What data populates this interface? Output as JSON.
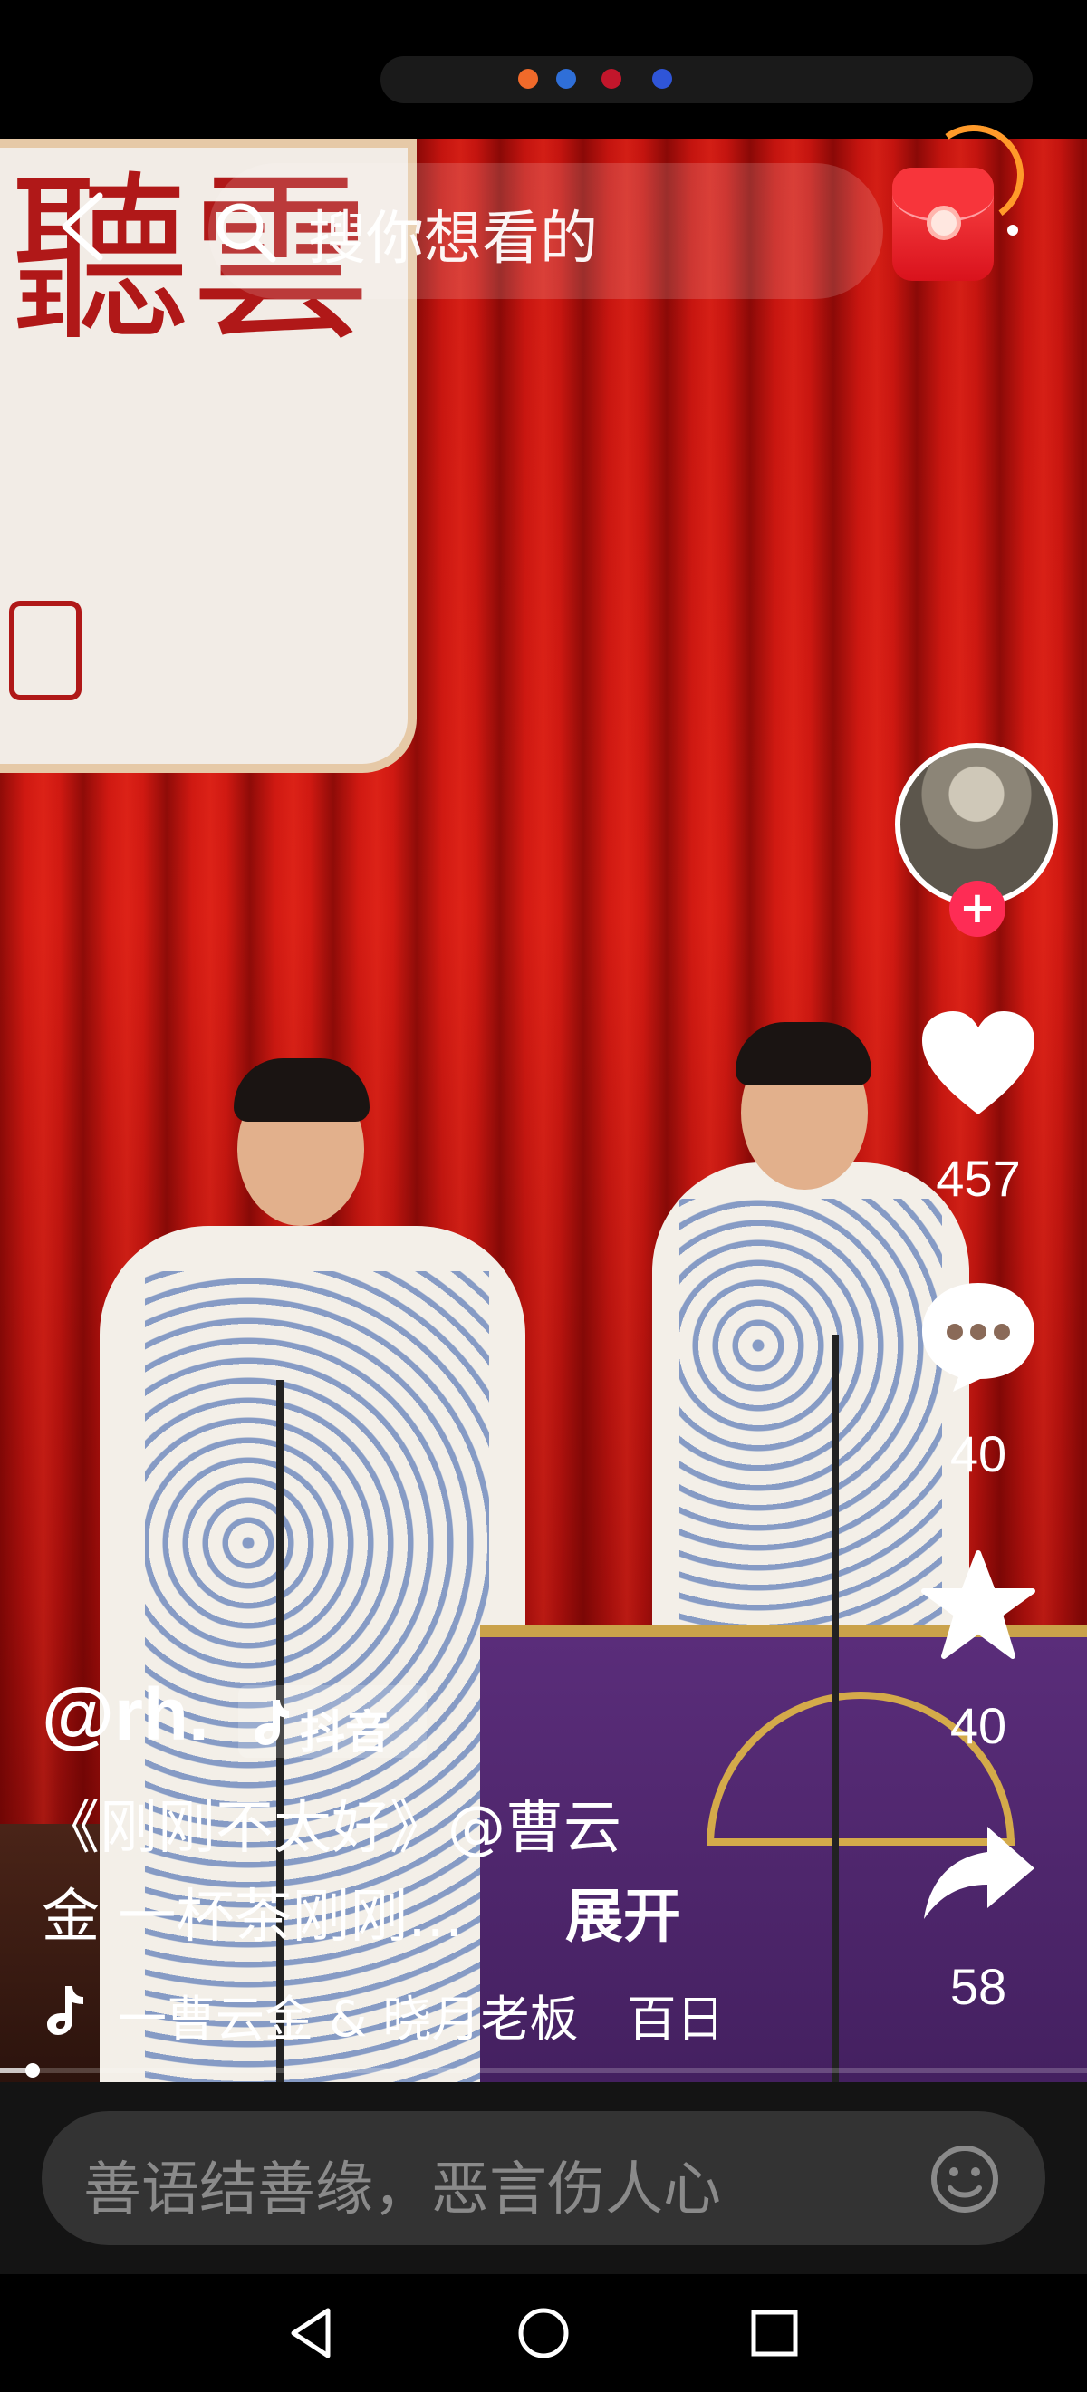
{
  "header": {
    "search_placeholder": "搜你想看的"
  },
  "video": {
    "banner_text": "聽雲"
  },
  "rail": {
    "likes": "457",
    "comments": "40",
    "favorites": "40",
    "shares": "58"
  },
  "caption": {
    "author": "@rh.",
    "brand_tag": "抖音",
    "line1": "《刚刚不太好》@曹云",
    "line2": "金 一杯茶刚刚...",
    "expand": "展开",
    "music": "一曹云金 & 晓月老板　百日"
  },
  "progress": {
    "fraction": 0.03
  },
  "comment": {
    "placeholder": "善语结善缘，恶言伤人心"
  },
  "colors": {
    "accent": "#fe2c55",
    "curtain": "#c4140f",
    "table": "#5a2d7a"
  },
  "icons": {
    "back": "back-arrow-icon",
    "search": "search-icon",
    "like": "heart-icon",
    "comment": "comment-icon",
    "favorite": "star-icon",
    "share": "share-icon",
    "music": "music-note-icon",
    "emoji": "emoji-icon"
  }
}
